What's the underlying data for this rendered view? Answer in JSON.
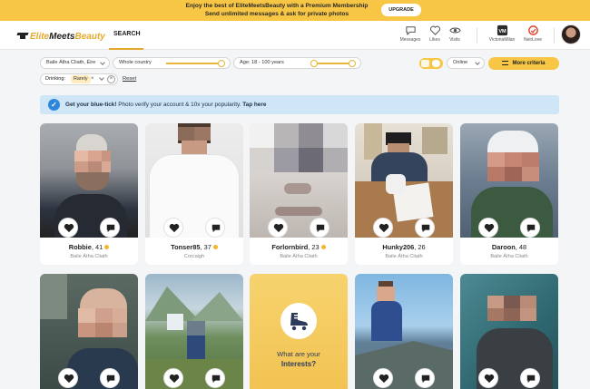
{
  "promo": {
    "line1": "Enjoy the best of EliteMeetsBeauty with a Premium Membership",
    "line2": "Send unlimited messages & ask for private photos",
    "upgrade_label": "UPGRADE"
  },
  "brand": {
    "part1": "Elite",
    "part2": "Meets",
    "part3": "Beauty"
  },
  "nav": {
    "search_label": "SEARCH",
    "icons": [
      {
        "name": "messages",
        "label": "Messages",
        "icon": "speech-bubble-icon"
      },
      {
        "name": "likes",
        "label": "Likes",
        "icon": "heart-icon"
      },
      {
        "name": "visits",
        "label": "Visits",
        "icon": "eye-icon"
      },
      {
        "name": "victoriamilan",
        "label": "VictoriaMilan",
        "icon": "vm-logo-icon"
      },
      {
        "name": "neirlove",
        "label": "NeirLove",
        "icon": "neirlove-logo-icon"
      }
    ]
  },
  "filters": {
    "location": "Baile Átha Cliath, Éire",
    "country": "Whole country",
    "age": "Age: 18 - 100 years",
    "status": "Online",
    "more_criteria": "More criteria",
    "drinking_label": "Drinking:",
    "drinking_value": "Rarely",
    "reset": "Reset"
  },
  "bluetick": {
    "bold": "Get your blue-tick!",
    "text": " Photo verify your account & 10x your popularity.",
    "link": " Tap here"
  },
  "profiles": [
    {
      "name": "Robbie",
      "age": "41",
      "location": "Baile Átha Cliath",
      "online": true
    },
    {
      "name": "Tonser85",
      "age": "37",
      "location": "Corcaigh",
      "online": true
    },
    {
      "name": "Forlornbird",
      "age": "23",
      "location": "Baile Átha Cliath",
      "online": true
    },
    {
      "name": "Hunky206",
      "age": "26",
      "location": "Baile Átha Cliath",
      "online": false
    },
    {
      "name": "Daroon",
      "age": "48",
      "location": "Baile Átha Cliath",
      "online": false
    }
  ],
  "interests": {
    "line1": "What are your",
    "line2": "Interests?"
  },
  "colors": {
    "accent": "#f6c644",
    "brand_gold": "#e2a92b",
    "bluetick_bg": "#cfe6f7",
    "online_dot": "#f2b632"
  }
}
